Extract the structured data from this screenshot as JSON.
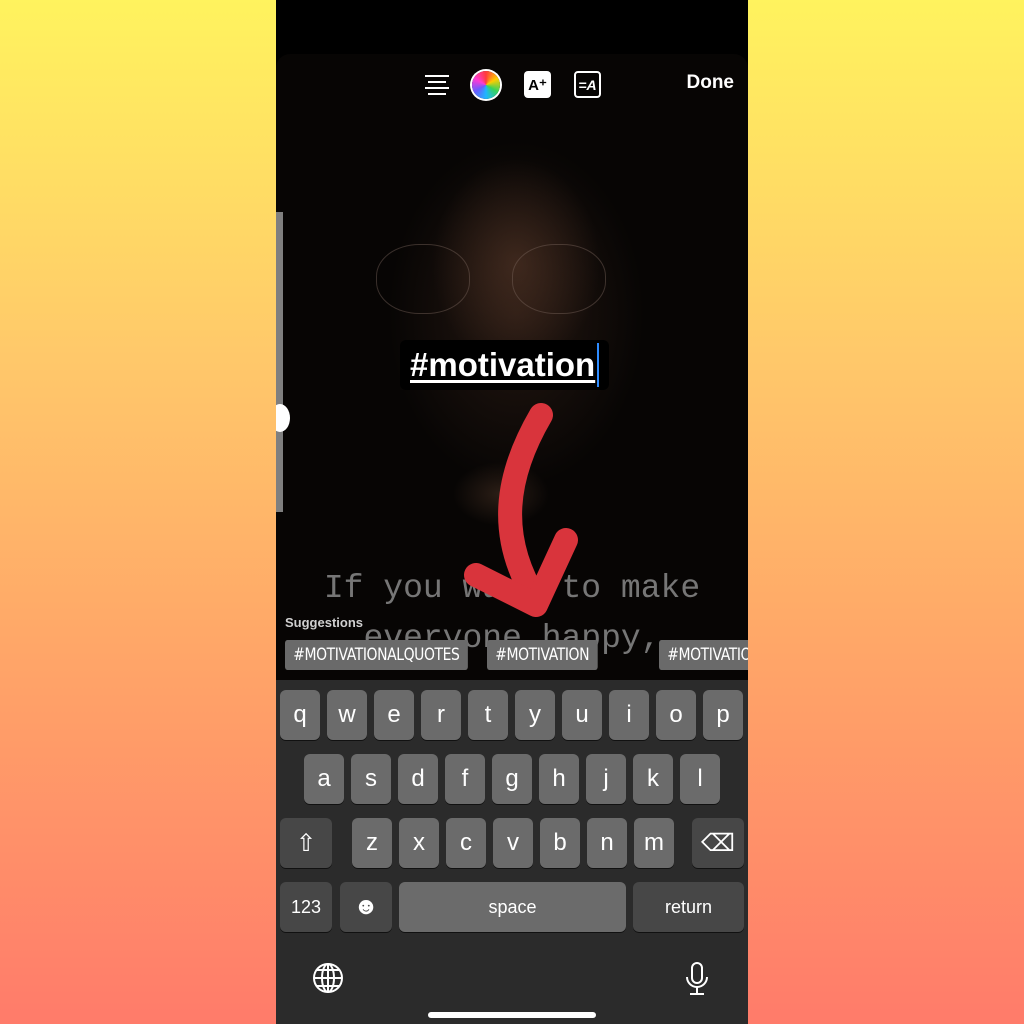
{
  "toolbar": {
    "icons": [
      "text-align-icon",
      "color-picker-icon",
      "text-effects-icon",
      "text-animation-icon"
    ],
    "effects_glyph": "A⁺",
    "animation_glyph": "=A",
    "done_label": "Done"
  },
  "editor": {
    "hashtag_text": "#motivation"
  },
  "background_quote": {
    "line1": "If you want to make",
    "line2": "everyone happy,"
  },
  "suggestions": {
    "label": "Suggestions",
    "chips": [
      "#MOTIVATIONALQUOTES",
      "#MOTIVATION",
      "#MOTIVATIONAL"
    ]
  },
  "keyboard": {
    "row1": [
      "q",
      "w",
      "e",
      "r",
      "t",
      "y",
      "u",
      "i",
      "o",
      "p"
    ],
    "row2": [
      "a",
      "s",
      "d",
      "f",
      "g",
      "h",
      "j",
      "k",
      "l"
    ],
    "row3": [
      "z",
      "x",
      "c",
      "v",
      "b",
      "n",
      "m"
    ],
    "shift_glyph": "⇧",
    "delete_glyph": "⌫",
    "numbers_label": "123",
    "emoji_glyph": "☻",
    "space_label": "space",
    "return_label": "return"
  },
  "colors": {
    "arrow": "#d9343c",
    "cursor": "#2e8cff"
  }
}
